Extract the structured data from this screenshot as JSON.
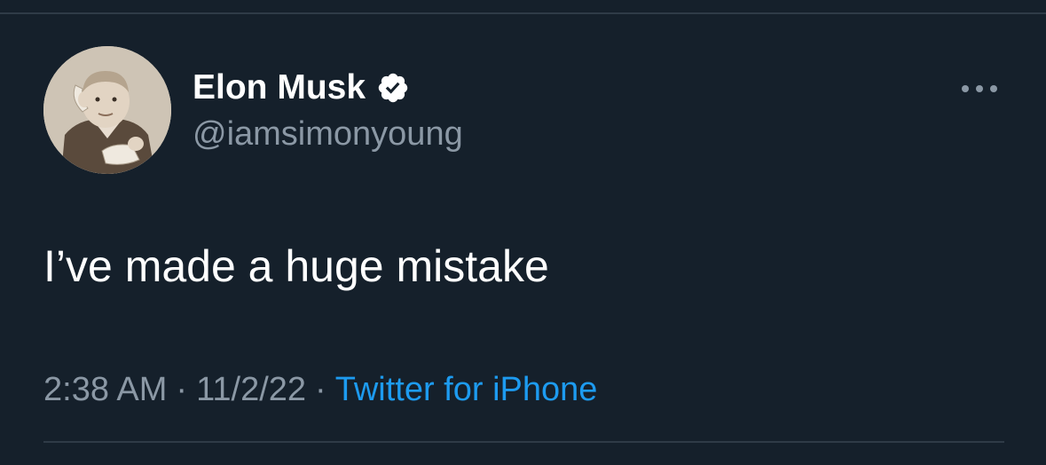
{
  "tweet": {
    "author": {
      "display_name": "Elon Musk",
      "handle": "@iamsimonyoung",
      "verified": true
    },
    "text": "I’ve made a huge mistake",
    "time": "2:38 AM",
    "date": "11/2/22",
    "separator": "·",
    "source": "Twitter for iPhone"
  },
  "icons": {
    "verified": "verified-badge-icon",
    "more": "more-options-icon"
  },
  "colors": {
    "background": "#15202b",
    "primary_text": "#ffffff",
    "secondary_text": "#8b98a5",
    "link": "#1d9bf0",
    "divider": "#2f3b47"
  }
}
